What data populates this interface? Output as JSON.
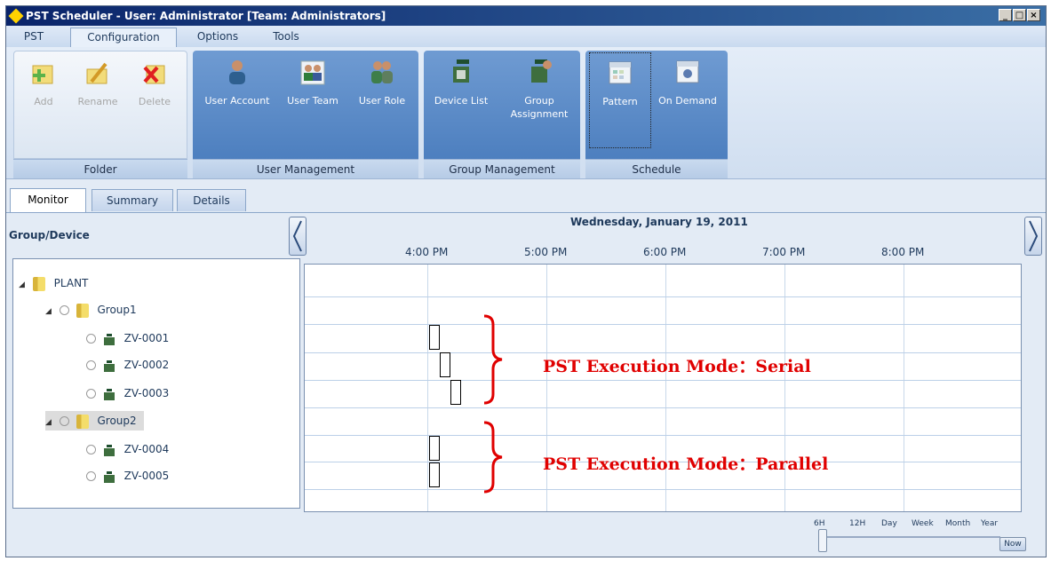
{
  "window": {
    "title": "PST Scheduler - User: Administrator [Team: Administrators]",
    "minimize": "_",
    "maximize": "□",
    "close": "×"
  },
  "menu": {
    "tabs": [
      {
        "label": "PST"
      },
      {
        "label": "Configuration"
      },
      {
        "label": "Options"
      },
      {
        "label": "Tools"
      }
    ],
    "active": "Configuration"
  },
  "ribbon": {
    "groups": [
      {
        "label": "Folder",
        "buttons": [
          "Add",
          "Rename",
          "Delete"
        ]
      },
      {
        "label": "User Management",
        "buttons": [
          "User Account",
          "User Team",
          "User Role"
        ]
      },
      {
        "label": "Group Management",
        "buttons": [
          "Device List",
          "Group Assignment"
        ]
      },
      {
        "label": "Schedule",
        "buttons": [
          "Pattern",
          "On Demand"
        ]
      }
    ]
  },
  "view_tabs": [
    {
      "label": "Monitor"
    },
    {
      "label": "Summary"
    },
    {
      "label": "Details"
    }
  ],
  "active_view_tab": "Monitor",
  "panel": {
    "header": "Group/Device"
  },
  "tree": {
    "root": "PLANT",
    "groups": [
      {
        "label": "Group1",
        "devices": [
          "ZV-0001",
          "ZV-0002",
          "ZV-0003"
        ]
      },
      {
        "label": "Group2",
        "devices": [
          "ZV-0004",
          "ZV-0005"
        ]
      }
    ],
    "selected": "Group2"
  },
  "timeline": {
    "date": "Wednesday, January 19, 2011",
    "hours": [
      "4:00 PM",
      "5:00 PM",
      "6:00 PM",
      "7:00 PM",
      "8:00 PM"
    ]
  },
  "annotations": {
    "serial": "PST Execution Mode：Serial",
    "parallel": "PST Execution Mode：Parallel"
  },
  "zoom": {
    "levels": [
      "6H",
      "12H",
      "Day",
      "Week",
      "Month",
      "Year"
    ],
    "current": "6H",
    "now_label": "Now"
  },
  "colors": {
    "ribbon_group": "#4d7fbf",
    "annotation": "#e00000",
    "title_bar": "#0a246a"
  }
}
